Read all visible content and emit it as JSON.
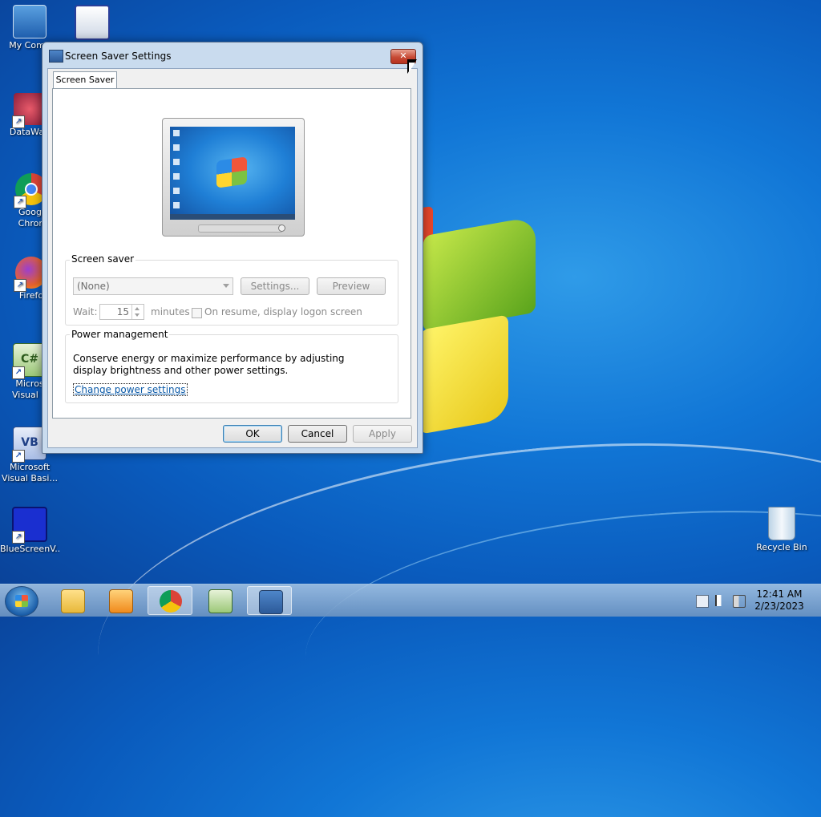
{
  "desktop": {
    "icons": [
      {
        "label": "My Comp"
      },
      {
        "label": ""
      },
      {
        "label": "DataWag"
      },
      {
        "label": "Googl"
      },
      {
        "label": "Chron"
      },
      {
        "label": "Firefo"
      },
      {
        "label": "Micros"
      },
      {
        "label": "Visual C"
      },
      {
        "label": "Microsoft"
      },
      {
        "label": "Visual Basi..."
      },
      {
        "label": "BlueScreenV..."
      },
      {
        "label": "Recycle Bin"
      }
    ]
  },
  "dialog": {
    "title": "Screen Saver Settings",
    "close_glyph": "✕",
    "tab_label": "Screen Saver",
    "screen_saver_group": {
      "legend": "Screen saver",
      "selected": "(None)",
      "settings_label": "Settings...",
      "preview_label": "Preview",
      "wait_label": "Wait:",
      "wait_value": "15",
      "minutes_label": "minutes",
      "resume_label": "On resume, display logon screen"
    },
    "power_group": {
      "legend": "Power management",
      "description": "Conserve energy or maximize performance by adjusting display brightness and other power settings.",
      "link": "Change power settings"
    },
    "buttons": {
      "ok": "OK",
      "cancel": "Cancel",
      "apply": "Apply"
    }
  },
  "taskbar": {
    "time": "12:41 AM",
    "date": "2/23/2023"
  },
  "colors": {
    "accent": "#0b5aa8",
    "close": "#c74a35"
  }
}
